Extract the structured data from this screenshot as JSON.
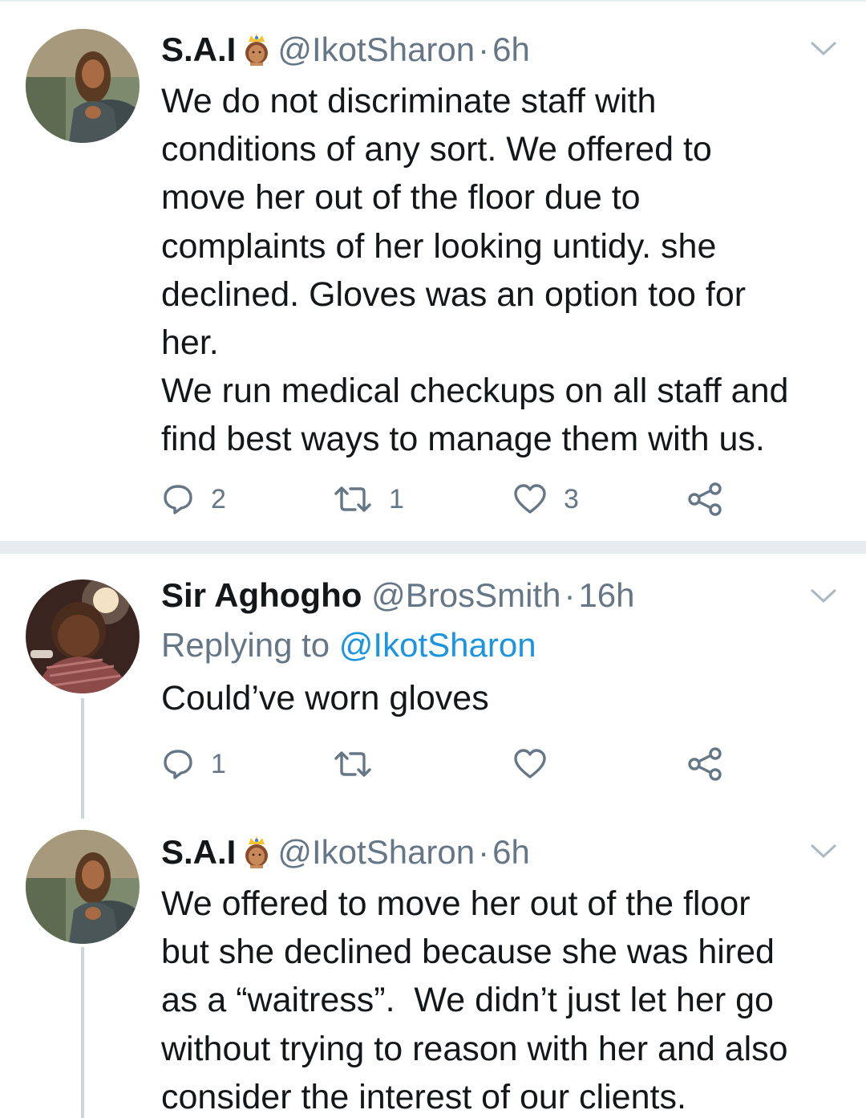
{
  "tweets": [
    {
      "display_name": "S.A.I",
      "handle": "@IkotSharon",
      "separator": "·",
      "time": "6h",
      "avatar": "avatar-woman-photo",
      "emoji": "princess-emoji",
      "text_lines": [
        "We do not discriminate staff with",
        "conditions of any sort. We offered to",
        "move her out of the floor due to",
        "complaints of her looking untidy. she",
        "declined. Gloves was an option too for",
        "her.",
        "We run medical checkups on all staff and",
        "find best ways to manage them with us."
      ],
      "replies": "2",
      "retweets": "1",
      "likes": "3"
    },
    {
      "display_name": "Sir Aghogho",
      "handle": "@BrosSmith",
      "separator": "·",
      "time": "16h",
      "avatar": "avatar-man-photo",
      "replying_label": "Replying to",
      "replying_handle": "@IkotSharon",
      "text_lines": [
        "Could’ve worn gloves"
      ],
      "replies": "1",
      "retweets": "",
      "likes": ""
    },
    {
      "display_name": "S.A.I",
      "handle": "@IkotSharon",
      "separator": "·",
      "time": "6h",
      "avatar": "avatar-woman-photo",
      "emoji": "princess-emoji",
      "text_lines": [
        "We offered to move her out of the floor",
        "but she declined because she was hired",
        "as a “waitress”.  We didn’t just let her go",
        "without trying to reason with her and also",
        "consider the interest of our clients."
      ]
    }
  ],
  "icons": {
    "reply": "reply-icon",
    "retweet": "retweet-icon",
    "like": "heart-icon",
    "share": "share-icon",
    "menu": "chevron-down-icon"
  },
  "colors": {
    "text": "#14171a",
    "secondary": "#657786",
    "link": "#1b95e0",
    "divider": "#e6ecf0",
    "thread_line": "#ccd6dd"
  }
}
